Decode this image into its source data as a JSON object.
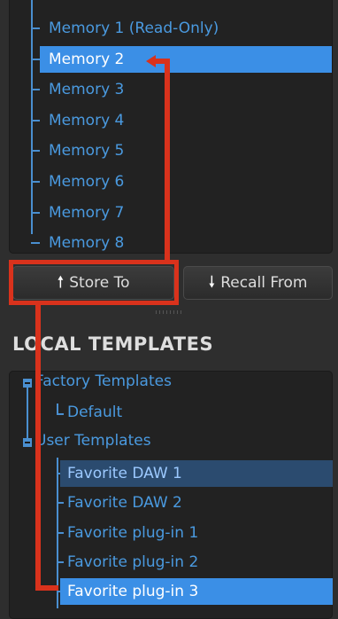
{
  "memory": {
    "items": [
      "Memory 1 (Read-Only)",
      "Memory 2",
      "Memory 3",
      "Memory 4",
      "Memory 5",
      "Memory 6",
      "Memory 7",
      "Memory 8"
    ],
    "selected_index": 1
  },
  "buttons": {
    "store_label": "Store To",
    "recall_label": "Recall From",
    "store_icon": "up-arrow-icon",
    "recall_icon": "down-arrow-icon"
  },
  "local_templates": {
    "title": "LOCAL TEMPLATES",
    "factory": {
      "label": "Factory Templates",
      "items": [
        "Default"
      ]
    },
    "user": {
      "label": "User Templates",
      "items": [
        "Favorite DAW 1",
        "Favorite DAW 2",
        "Favorite plug-in 1",
        "Favorite plug-in 2",
        "Favorite plug-in 3"
      ]
    }
  },
  "colors": {
    "accent": "#3b8fe6",
    "text_blue": "#4a9ae0",
    "annotation_red": "#d9321c"
  }
}
